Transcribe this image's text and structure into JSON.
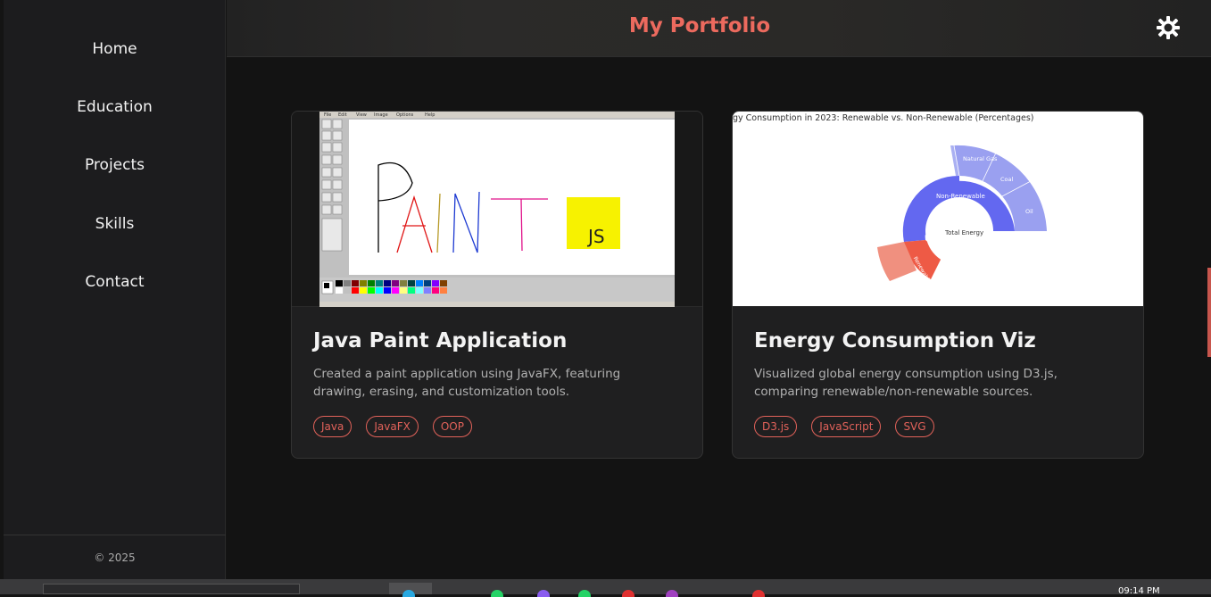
{
  "sidebar": {
    "items": [
      {
        "label": "Home"
      },
      {
        "label": "Education"
      },
      {
        "label": "Projects"
      },
      {
        "label": "Skills"
      },
      {
        "label": "Contact"
      }
    ],
    "copyright": "© 2025"
  },
  "header": {
    "title": "My Portfolio",
    "theme_icon": "sun-icon"
  },
  "projects": [
    {
      "title": "Java Paint Application",
      "description": "Created a paint application using JavaFX, featuring drawing, erasing, and customization tools.",
      "tags": [
        "Java",
        "JavaFX",
        "OOP"
      ],
      "image": {
        "menu": [
          "File",
          "Edit",
          "View",
          "Image",
          "Options",
          "Help"
        ],
        "canvas_text": "PAINT",
        "badge": "JS"
      }
    },
    {
      "title": "Energy Consumption Viz",
      "description": "Visualized global energy consumption using D3.js, comparing renewable/non-renewable sources.",
      "tags": [
        "D3.js",
        "JavaScript",
        "SVG"
      ],
      "image": {
        "chart_title": "gy Consumption in 2023: Renewable vs. Non-Renewable (Percentages)",
        "center": "Total Energy",
        "ring": [
          "Non-Renewable",
          "Renewable"
        ],
        "outer": [
          "Natural Gas",
          "Coal",
          "Oil"
        ]
      }
    }
  ],
  "taskbar": {
    "clock": "09:14 PM"
  },
  "colors": {
    "accent": "#ec6a5e",
    "background": "#131313",
    "sidebar": "#1c1c1e"
  }
}
